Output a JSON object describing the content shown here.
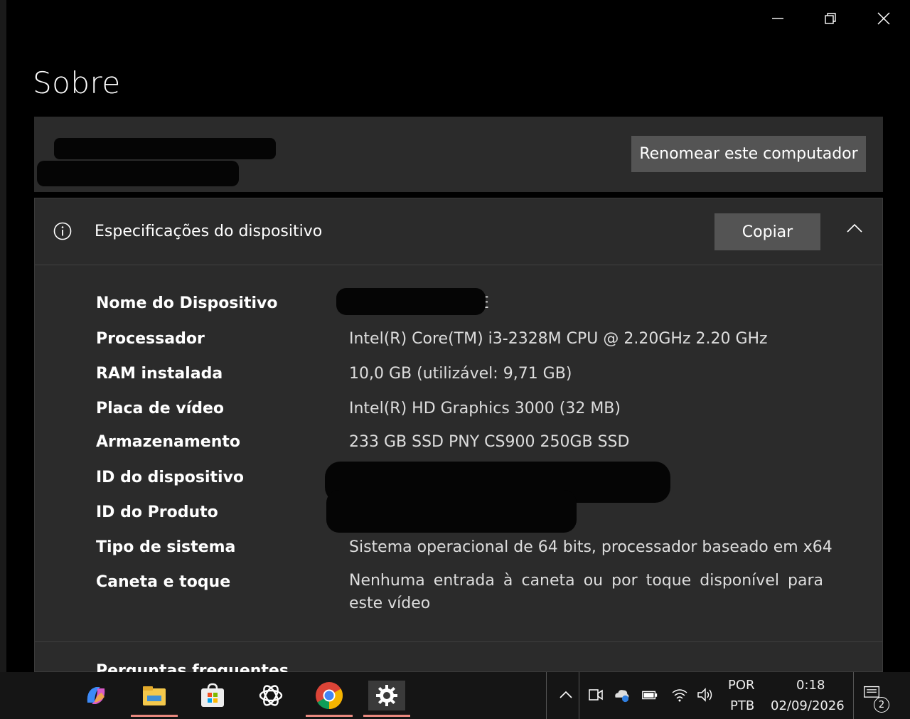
{
  "window": {
    "title": "Sobre",
    "controls": [
      "minimize-icon",
      "restore-icon",
      "close-icon"
    ]
  },
  "device_card": {
    "rename_button": "Renomear este computador"
  },
  "specs": {
    "header": "Especificações do dispositivo",
    "copy_button": "Copiar",
    "rows": [
      {
        "label": "Nome do Dispositivo",
        "value": "E"
      },
      {
        "label": "Processador",
        "value": "Intel(R) Core(TM) i3-2328M CPU @ 2.20GHz   2.20 GHz"
      },
      {
        "label": "RAM instalada",
        "value": "10,0 GB (utilizável: 9,71 GB)"
      },
      {
        "label": "Placa de vídeo",
        "value": "Intel(R) HD Graphics 3000 (32 MB)"
      },
      {
        "label": "Armazenamento",
        "value": "233 GB SSD PNY CS900 250GB SSD"
      },
      {
        "label": "ID do dispositivo",
        "value": ""
      },
      {
        "label": "ID do Produto",
        "value": ""
      },
      {
        "label": "Tipo de sistema",
        "value": "Sistema operacional de 64 bits, processador baseado em x64"
      },
      {
        "label": "Caneta e toque",
        "value": "Nenhuma entrada à caneta ou por toque disponível para este vídeo"
      }
    ]
  },
  "faq": {
    "title": "Perguntas frequentes"
  },
  "taskbar": {
    "apps": [
      "copilot-icon",
      "file-explorer-icon",
      "microsoft-store-icon",
      "chatgpt-icon",
      "chrome-icon",
      "settings-icon"
    ],
    "language_top": "POR",
    "language_bottom": "PTB",
    "time": "0:18",
    "date": "02/09/2026",
    "notification_count": "2"
  },
  "colors": {
    "background": "#000000",
    "card": "#2b2b2b",
    "button": "#545454",
    "taskbar": "#151515",
    "taskbar_active_underline": "#e9897f"
  }
}
